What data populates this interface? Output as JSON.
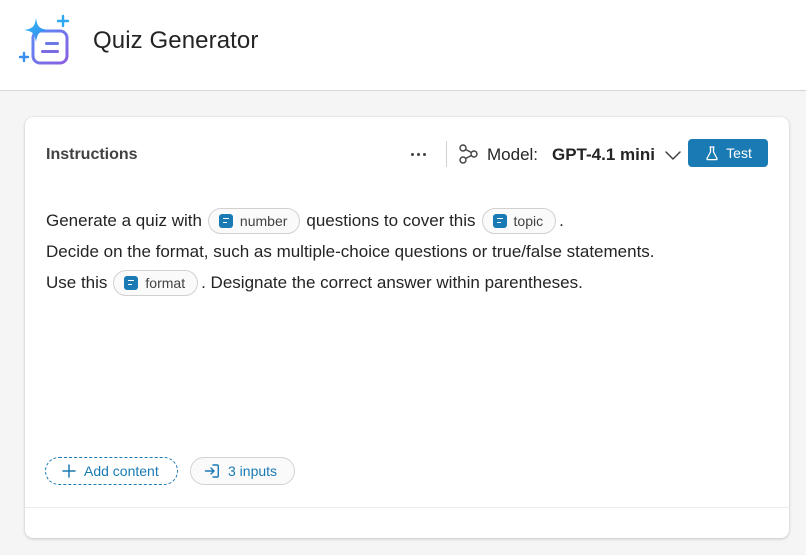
{
  "app": {
    "title": "Quiz Generator",
    "logo_icon": "sparkle-document-icon"
  },
  "card": {
    "title": "Instructions",
    "more_icon": "more-horizontal-icon",
    "model": {
      "icon": "flow-nodes-icon",
      "label": "Model:",
      "value": "GPT-4.1 mini"
    },
    "test_button": {
      "label": "Test",
      "icon": "beaker-icon"
    },
    "instructions": {
      "line1_prefix": "Generate a quiz with",
      "chip_number": "number",
      "line1_middle": "questions to cover this",
      "chip_topic": "topic",
      "line1_suffix": ".",
      "line2": "Decide on the format, such as multiple-choice questions or true/false statements.",
      "line3_prefix": "Use this",
      "chip_format": "format",
      "line3_suffix": ". Designate the correct answer within parentheses."
    },
    "add_content_label": "Add content",
    "inputs_label": "3 inputs"
  },
  "colors": {
    "accent": "#1a7ab3",
    "logo_blue": "#3aa0f3",
    "logo_purple": "#7b61d9"
  }
}
